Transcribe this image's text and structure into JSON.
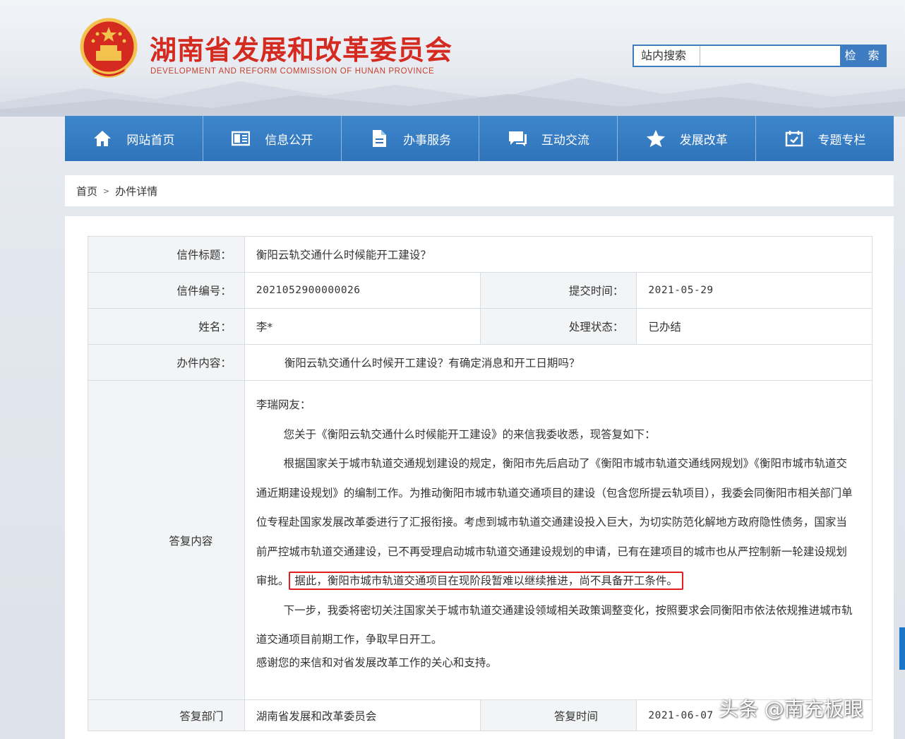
{
  "header": {
    "title": "湖南省发展和改革委员会",
    "subtitle": "DEVELOPMENT AND REFORM COMMISSION OF HUNAN PROVINCE",
    "search_label": "站内搜索",
    "search_placeholder": "",
    "search_button": "检 索"
  },
  "nav": {
    "items": [
      {
        "label": "网站首页",
        "icon": "home-icon"
      },
      {
        "label": "信息公开",
        "icon": "book-icon"
      },
      {
        "label": "办事服务",
        "icon": "document-icon"
      },
      {
        "label": "互动交流",
        "icon": "chat-icon"
      },
      {
        "label": "发展改革",
        "icon": "star-icon"
      },
      {
        "label": "专题专栏",
        "icon": "calendar-icon"
      }
    ]
  },
  "breadcrumb": {
    "home": "首页",
    "separator": ">",
    "current": "办件详情"
  },
  "detail": {
    "letter_title_label": "信件标题：",
    "letter_title": "衡阳云轨交通什么时候能开工建设？",
    "letter_no_label": "信件编号：",
    "letter_no": "2021052900000026",
    "submit_time_label": "提交时间：",
    "submit_time": "2021-05-29",
    "name_label": "姓名：",
    "name": "李*",
    "status_label": "处理状态：",
    "status": "已办结",
    "content_label": "办件内容：",
    "content": "衡阳云轨交通什么时候开工建设？有确定消息和开工日期吗？",
    "reply_label": "答复内容",
    "reply": {
      "greeting": "李瑞网友：",
      "p1": "您关于《衡阳云轨交通什么时候能开工建设》的来信我委收悉，现答复如下：",
      "p2_before": "根据国家关于城市轨道交通规划建设的规定，衡阳市先后启动了《衡阳市城市轨道交通线网规划》《衡阳市城市轨道交通近期建设规划》的编制工作。为推动衡阳市城市轨道交通项目的建设（包含您所提云轨项目），我委会同衡阳市相关部门单位专程赴国家发展改革委进行了汇报衔接。考虑到城市轨道交通建设投入巨大，为切实防范化解地方政府隐性债务，国家当前严控城市轨道交通建设，已不再受理启动城市轨道交通建设规划的申请，已有在建项目的城市也从严控制新一轮建设规划审批。",
      "p2_highlight": "据此，衡阳市城市轨道交通项目在现阶段暂难以继续推进，尚不具备开工条件。",
      "p3": "下一步，我委将密切关注国家关于城市轨道交通建设领域相关政策调整变化，按照要求会同衡阳市依法依规推进城市轨道交通项目前期工作，争取早日开工。",
      "p4": "感谢您的来信和对省发展改革工作的关心和支持。"
    },
    "dept_label": "答复部门",
    "dept": "湖南省发展和改革委员会",
    "reply_time_label": "答复时间",
    "reply_time": "2021-06-07"
  },
  "watermark": "头条 @南充板眼",
  "colors": {
    "brand_red": "#d42a20",
    "nav_blue": "#2f74bb",
    "highlight_red": "#e02020"
  }
}
